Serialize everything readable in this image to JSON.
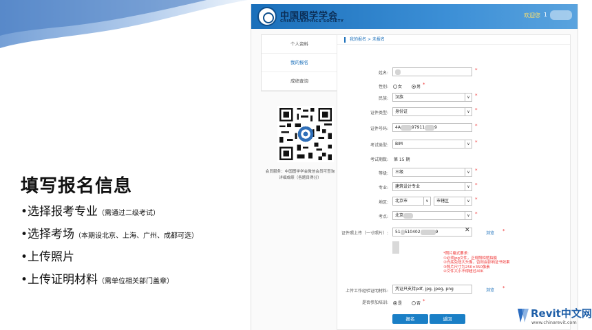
{
  "slide": {
    "title": "填写报名信息",
    "bullets": [
      {
        "text": "•选择报考专业",
        "note": "（需通过二级考试）"
      },
      {
        "text": "•选择考场",
        "note": "（本期设北京、上海、广州、成都可选）"
      },
      {
        "text": "•上传照片",
        "note": ""
      },
      {
        "text": "•上传证明材料",
        "note": "（需单位相关部门盖章）"
      }
    ]
  },
  "header": {
    "logo_cn": "中国图学学会",
    "logo_en": "CHINA GRAPHICS SOCIETY",
    "welcome": "欢迎您",
    "user_suffix": "1"
  },
  "sidebar": {
    "items": [
      {
        "label": "个人资料",
        "active": false
      },
      {
        "label": "我的报名",
        "active": true
      },
      {
        "label": "成绩查询",
        "active": false
      }
    ],
    "qr_caption": "会员服务：中国图学学会微信会员可查询详细成绩（各题目得分）"
  },
  "breadcrumb": "我的报名 > 未报名",
  "form": {
    "name_label": "姓名:",
    "gender_label": "性别:",
    "gender_female": "女",
    "gender_male": "男",
    "ethnicity_label": "民族:",
    "ethnicity_value": "汉族",
    "id_type_label": "证件类型:",
    "id_type_value": "身份证",
    "id_number_label": "证件号码:",
    "id_number_start": "4A",
    "id_number_mid": "97911",
    "id_number_end": "9",
    "exam_type_label": "考试类型:",
    "exam_type_value": "BIM",
    "session_label": "考试期数:",
    "session_value": "第 15 期",
    "level_label": "等级:",
    "level_value": "三级",
    "major_label": "专业:",
    "major_value": "建筑设计专业",
    "region_label": "地区:",
    "region_city": "北京市",
    "region_district": "市辖区",
    "site_label": "考点:",
    "site_value": "北京",
    "photo_label": "证件照上传（一寸照片）:",
    "photo_value_start": "51",
    "photo_value_mid": "510402",
    "photo_value_end": "9",
    "clear_mark": "✕",
    "browse_label": "浏览",
    "photo_requirements": [
      "*照片格式要求:",
      "①必须jpg文件，正规照相馆拍摄",
      "②白底免冠大头像，否则会影响证书效果",
      "③照片尺寸为250×350像素",
      "④文件大小不得超过40K"
    ],
    "work_proof_label": "上传工作经验证明材料:",
    "work_proof_value": "凭证只支持pdf, jpg, jpeg, png",
    "training_label": "是否参加培训:",
    "training_yes": "是",
    "training_no": "否",
    "required_mark": "*",
    "submit_label": "报名",
    "back_label": "返回"
  },
  "brand": {
    "name": "Revit中文网",
    "url": "www.chinarevit.com"
  }
}
